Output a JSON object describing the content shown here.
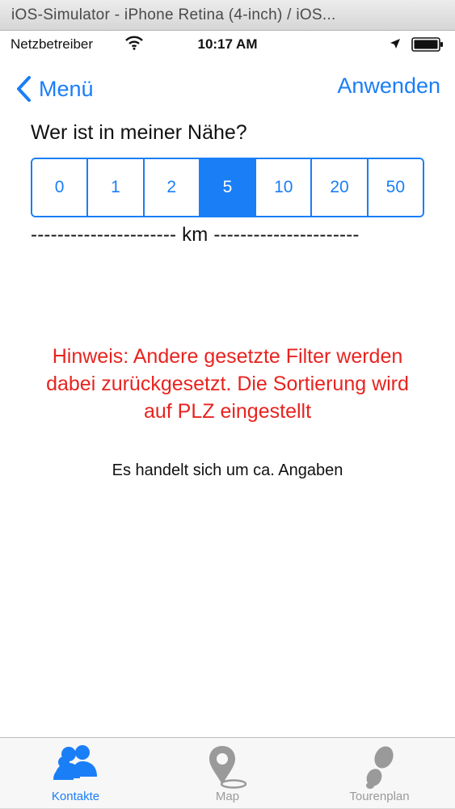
{
  "window": {
    "title": "iOS-Simulator - iPhone Retina (4-inch) / iOS..."
  },
  "status_bar": {
    "carrier": "Netzbetreiber",
    "time": "10:17 AM"
  },
  "nav": {
    "back_label": "Menü",
    "apply_label": "Anwenden"
  },
  "filter": {
    "question": "Wer ist in meiner Nähe?",
    "options": [
      "0",
      "1",
      "2",
      "5",
      "10",
      "20",
      "50"
    ],
    "selected": "5",
    "unit_line": "---------------------- km ----------------------"
  },
  "hint_text": "Hinweis: Andere gesetzte Filter werden dabei zurückgesetzt. Die Sortierung wird auf PLZ eingestellt",
  "info_text": "Es handelt sich um ca. Angaben",
  "tabs": [
    {
      "label": "Kontakte",
      "icon": "contacts-icon",
      "active": true
    },
    {
      "label": "Map",
      "icon": "map-pin-icon",
      "active": false
    },
    {
      "label": "Tourenplan",
      "icon": "footprints-icon",
      "active": false
    }
  ],
  "colors": {
    "accent": "#1a7ef7",
    "warning": "#e8231f",
    "inactive": "#9a9a9a"
  }
}
